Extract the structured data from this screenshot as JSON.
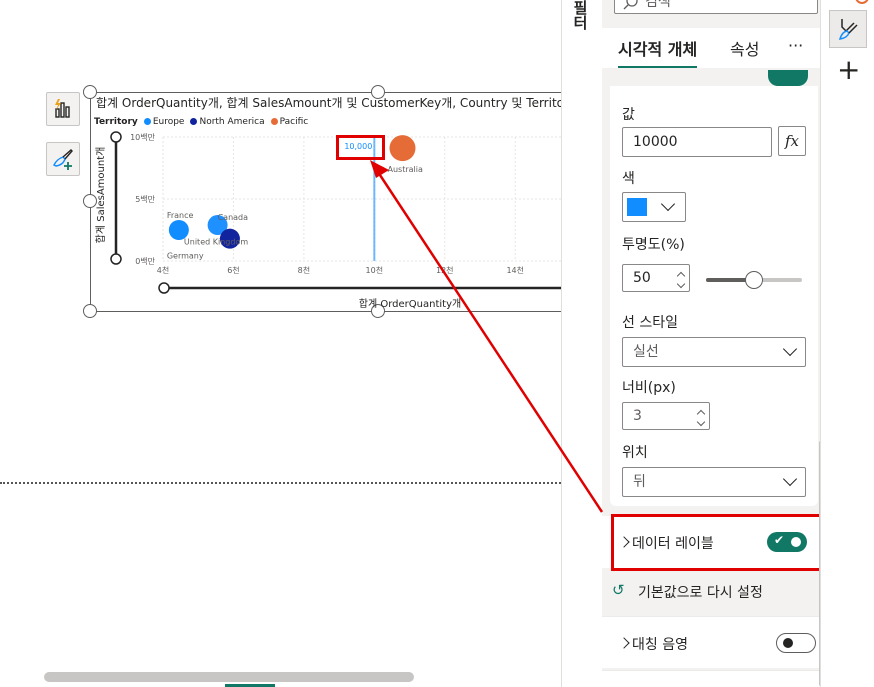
{
  "visual": {
    "title": "합계 OrderQuantity개, 합계 SalesAmount개 및 CustomerKey개, Country 및 Territory",
    "legend_title": "Territory",
    "legend_items": [
      {
        "label": "Europe",
        "color": "#118dff"
      },
      {
        "label": "North America",
        "color": "#12239e"
      },
      {
        "label": "Pacific",
        "color": "#e66c37"
      }
    ]
  },
  "chart_data": {
    "type": "scatter",
    "x_title": "합계 OrderQuantity개",
    "y_title": "합계 SalesAmount개",
    "x_ticks": [
      "4천",
      "6천",
      "8천",
      "10천",
      "12천",
      "14천"
    ],
    "x_tick_values": [
      4000,
      6000,
      8000,
      10000,
      12000,
      14000
    ],
    "y_ticks": [
      "0백만",
      "5백만",
      "10백만"
    ],
    "y_tick_values": [
      0,
      5000000,
      10000000
    ],
    "xlim": [
      4000,
      15300
    ],
    "ylim": [
      0,
      10000000
    ],
    "reference_line": {
      "x": 10000,
      "label": "10,000",
      "color": "#118dff"
    },
    "points": [
      {
        "label": "France",
        "x": 4450,
        "y": 2500000,
        "territory": "Europe",
        "color": "#118dff",
        "size": 10
      },
      {
        "label": "Germany",
        "x": 4450,
        "y": 2300000,
        "territory": "Europe",
        "color": "#118dff",
        "size": 0
      },
      {
        "label": "Canada",
        "x": 5550,
        "y": 2900000,
        "territory": "North America",
        "color": "#1e90ff",
        "size": 10
      },
      {
        "label": "United Kingdom",
        "x": 5900,
        "y": 1800000,
        "territory": "Europe",
        "color": "#12239e",
        "size": 10
      },
      {
        "label": "Australia",
        "x": 10800,
        "y": 9100000,
        "territory": "Pacific",
        "color": "#e66c37",
        "size": 13
      }
    ]
  },
  "strip": {
    "label": "필터"
  },
  "pane": {
    "search_placeholder": "검색",
    "tabs": [
      "시각적 개체",
      "속성"
    ],
    "more": "···",
    "value_label": "값",
    "value": "10000",
    "fx": "fx",
    "color_label": "색",
    "color": "#118dff",
    "transparency_label": "투명도(%)",
    "transparency": "50",
    "transparency_level": 0.5,
    "line_style_label": "선 스타일",
    "line_style": "실선",
    "width_label": "너비(px)",
    "width_value": "3",
    "position_label": "위치",
    "position": "뒤",
    "data_labels": {
      "label": "데이터 레이블",
      "on": true
    },
    "reset": "기본값으로 다시 설정",
    "symmetry": {
      "label": "대칭 음영",
      "on": false
    }
  },
  "accent": "#117865",
  "highlight_color": "#e00000"
}
